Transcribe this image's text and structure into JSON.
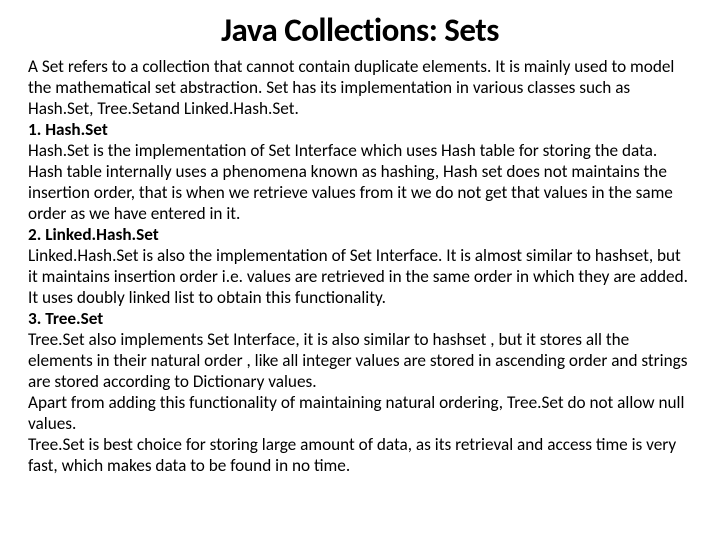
{
  "title": "Java Collections: Sets",
  "para_intro": "A Set refers to a collection that cannot contain duplicate elements. It is mainly used to model the mathematical set abstraction. Set has its implementation in various classes such as Hash.Set, Tree.Setand Linked.Hash.Set.",
  "h1": "1. Hash.Set",
  "p1": "Hash.Set is the implementation of Set Interface which uses Hash table for storing the data. Hash table internally uses a phenomena known as hashing, Hash set does not maintains the insertion order, that is when we retrieve values from it  we do not get that values in the same order as we have entered in it.",
  "h2": "2. Linked.Hash.Set",
  "p2": "Linked.Hash.Set is also the implementation of Set Interface. It is almost similar to hashset, but it maintains insertion order i.e. values are retrieved in the same order in which they are added. It uses doubly linked list to obtain this functionality.",
  "h3": "3. Tree.Set",
  "p3": "Tree.Set  also implements Set Interface, it is also similar to hashset , but it stores all the elements in their natural order , like all integer values are stored in ascending order   and strings are stored according to Dictionary values.",
  "p4": "Apart from adding this functionality of maintaining natural ordering, Tree.Set do not allow null values.",
  "p5": "Tree.Set is best choice for storing large amount of data, as its retrieval and access time is very fast, which makes data to be found in no time."
}
